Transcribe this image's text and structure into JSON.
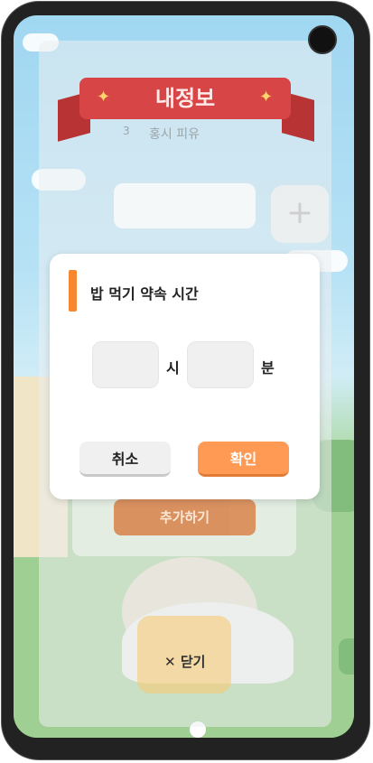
{
  "background": {
    "banner_title": "내정보",
    "subtitle_number": "3",
    "subtitle": "홍시 피유",
    "add_button_label": "추가하기",
    "close_label": "닫기",
    "close_icon": "close-icon",
    "plus_icon": "plus-icon"
  },
  "dialog": {
    "title": "밥 먹기 약속 시간",
    "hour_value": "",
    "hour_unit": "시",
    "minute_value": "",
    "minute_unit": "분",
    "cancel_label": "취소",
    "confirm_label": "확인"
  },
  "colors": {
    "accent": "#f6872f",
    "confirm": "#ff9a55",
    "banner": "#d74546"
  }
}
